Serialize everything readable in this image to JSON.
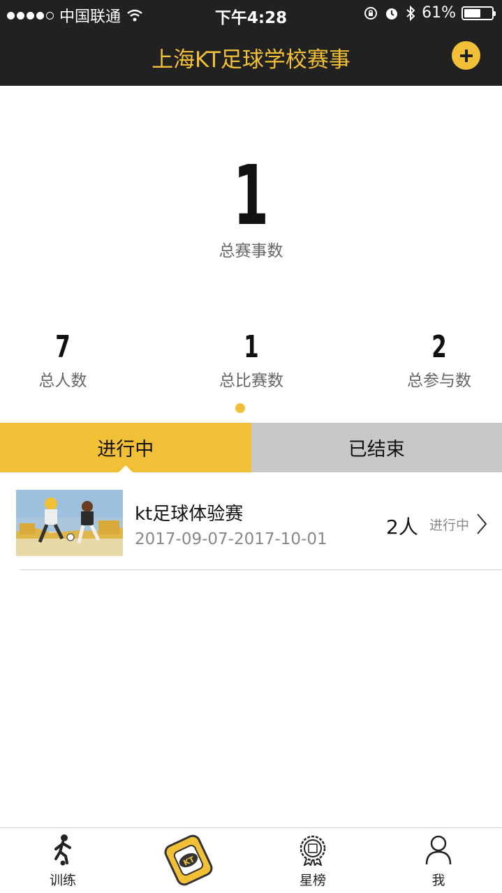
{
  "status_bar": {
    "carrier": "中国联通",
    "time": "下午4:28",
    "battery_percent": "61%",
    "battery_level": 0.61
  },
  "nav": {
    "title": "上海KT足球学校赛事",
    "add_icon": "plus-circle-icon"
  },
  "stats": {
    "total_events": {
      "value": "1",
      "label": "总赛事数"
    },
    "total_people": {
      "value": "7",
      "label": "总人数"
    },
    "total_matches": {
      "value": "1",
      "label": "总比赛数"
    },
    "total_participation": {
      "value": "2",
      "label": "总参与数"
    }
  },
  "tabs": [
    {
      "label": "进行中",
      "active": true
    },
    {
      "label": "已结束",
      "active": false
    }
  ],
  "events": [
    {
      "title": "kt足球体验赛",
      "date_range": "2017-09-07-2017-10-01",
      "count": "2人",
      "status": "进行中"
    }
  ],
  "bottom_nav": [
    {
      "label": "训练",
      "icon": "soccer-player-icon"
    },
    {
      "label": "",
      "icon": "kt-logo-icon"
    },
    {
      "label": "星榜",
      "icon": "ranking-badge-icon"
    },
    {
      "label": "我",
      "icon": "user-icon"
    }
  ],
  "colors": {
    "accent": "#f2c037",
    "header_bg": "#212121",
    "tab_inactive": "#c8c8c8"
  }
}
